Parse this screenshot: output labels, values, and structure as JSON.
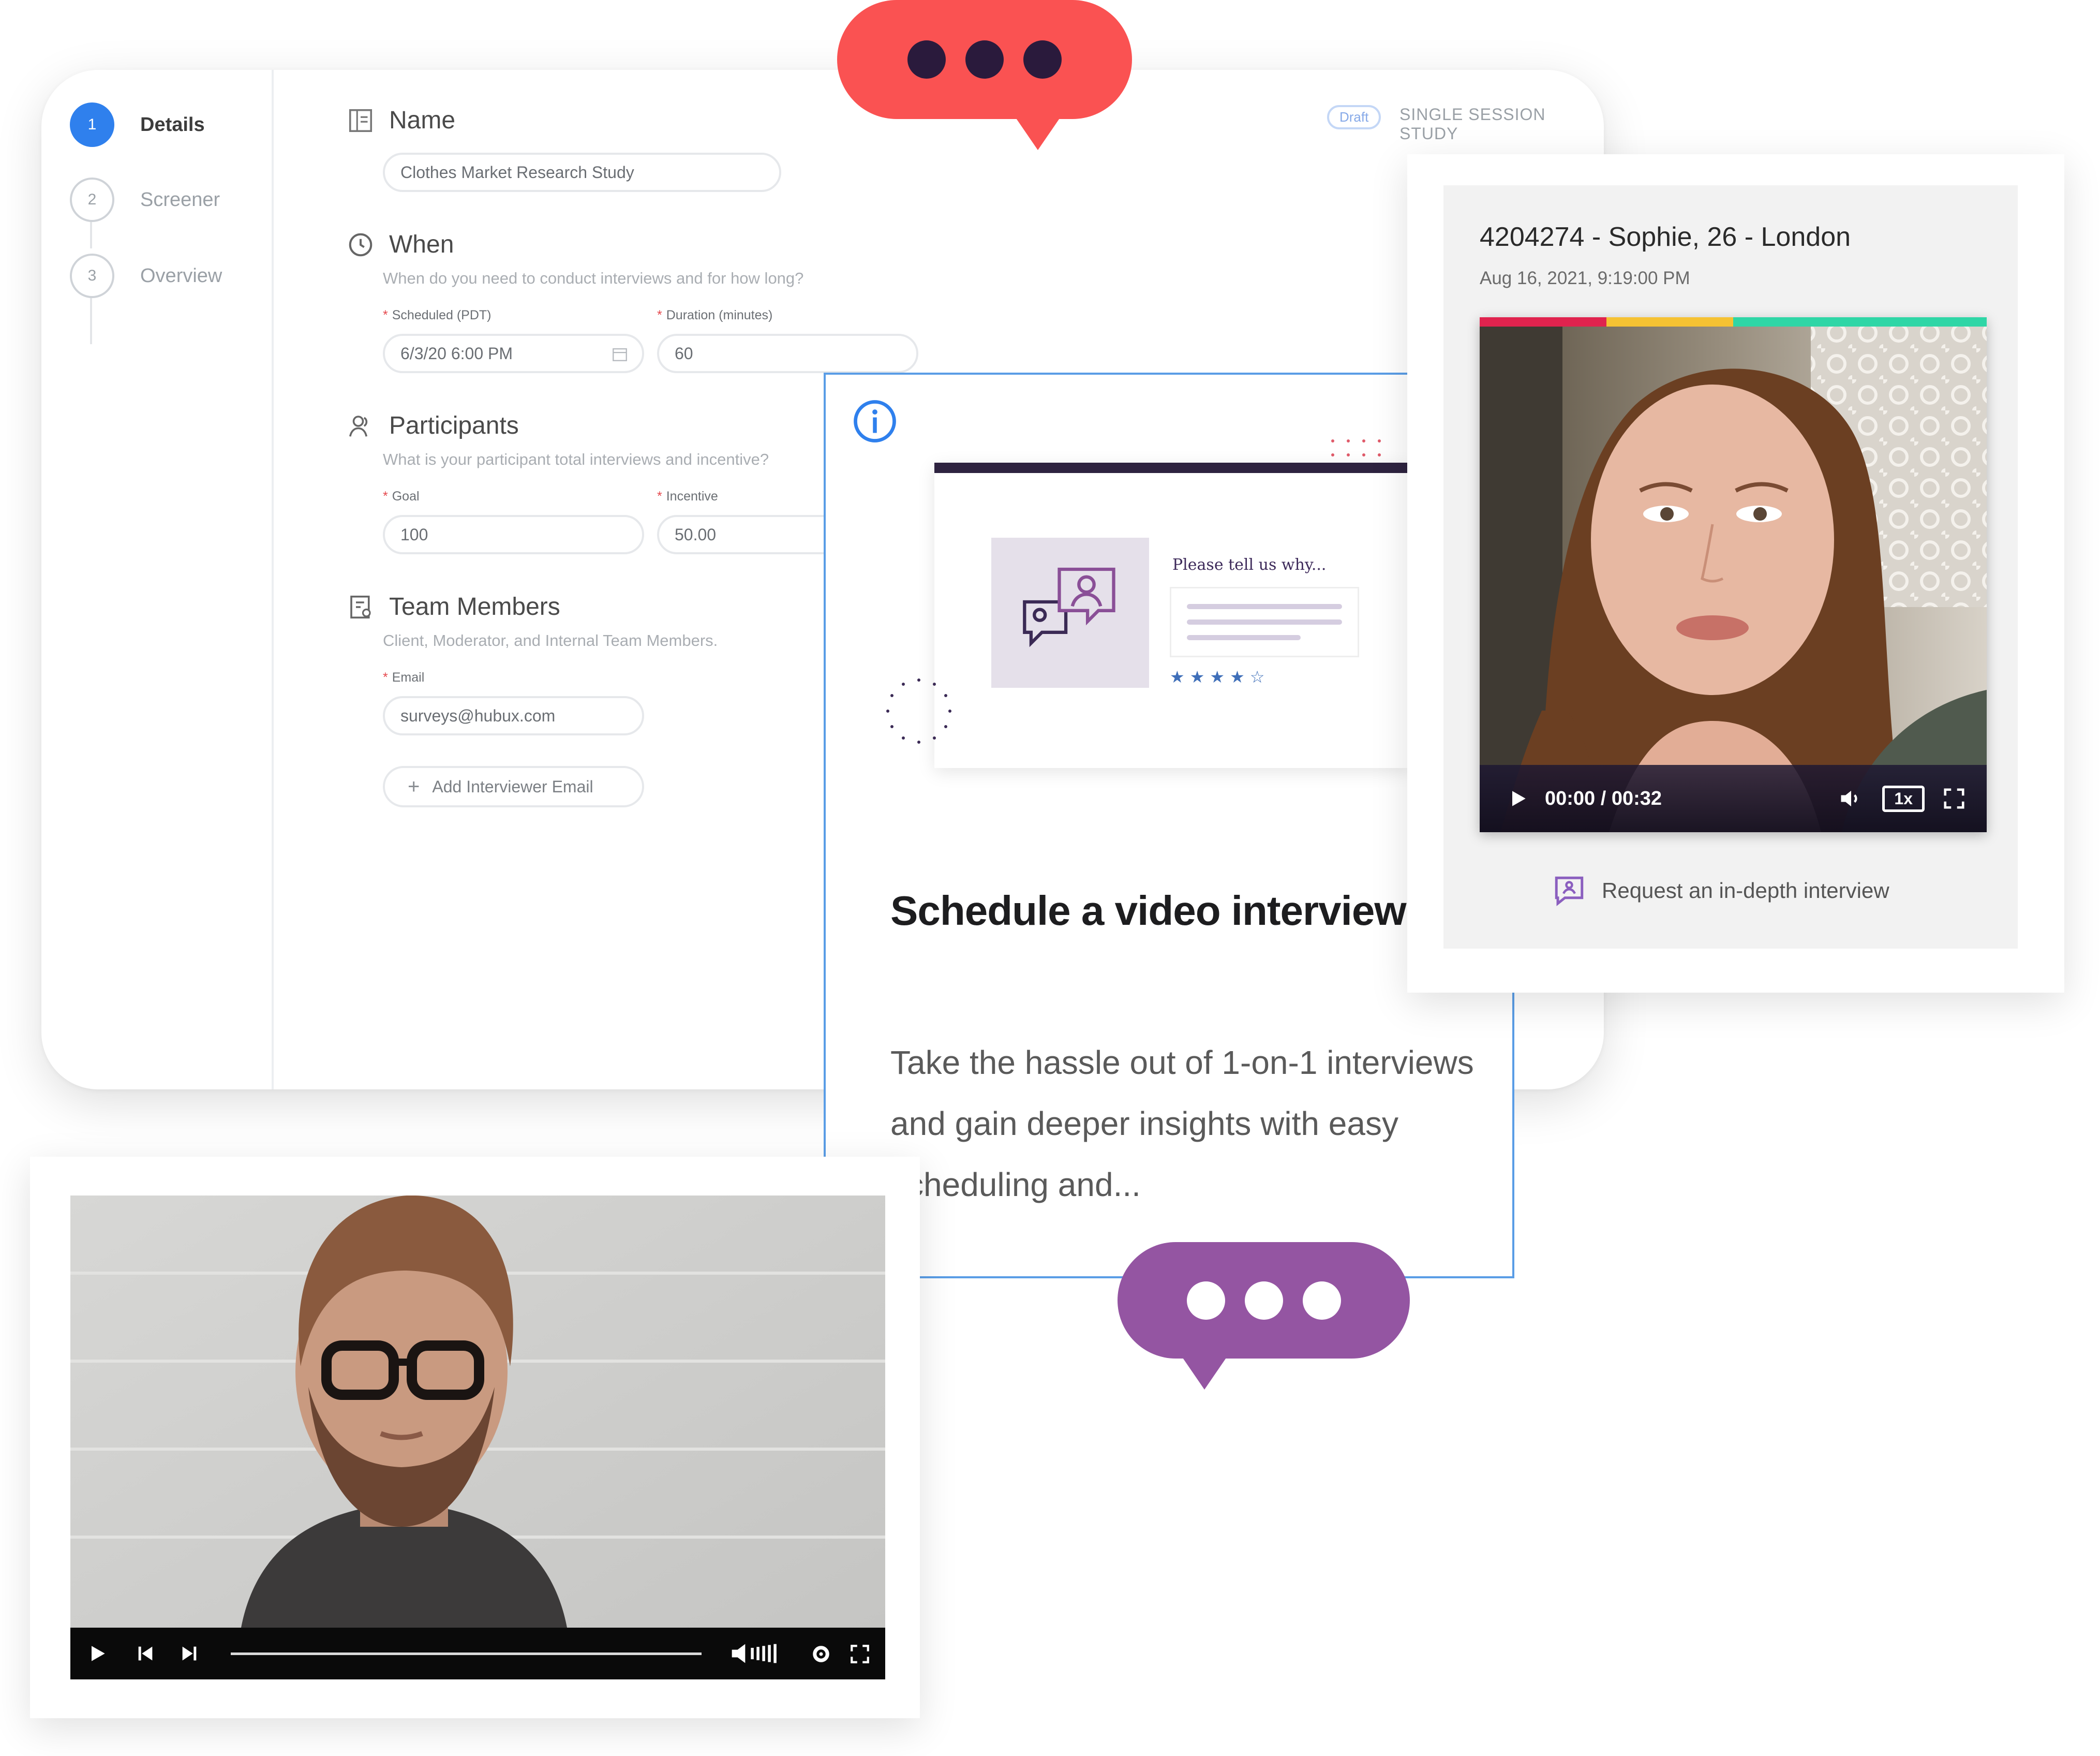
{
  "form": {
    "steps": [
      {
        "number": "1",
        "label": "Details",
        "active": true
      },
      {
        "number": "2",
        "label": "Screener",
        "active": false
      },
      {
        "number": "3",
        "label": "Overview",
        "active": false
      }
    ],
    "status_badge": "Draft",
    "study_type": "SINGLE SESSION STUDY",
    "name": {
      "title": "Name",
      "value": "Clothes Market Research Study"
    },
    "when": {
      "title": "When",
      "hint": "When do you need to conduct interviews and for how long?",
      "scheduled_label": "Scheduled (PDT)",
      "scheduled_value": "6/3/20 6:00 PM",
      "duration_label": "Duration (minutes)",
      "duration_value": "60"
    },
    "participants": {
      "title": "Participants",
      "hint": "What is your participant total interviews and incentive?",
      "goal_label": "Goal",
      "goal_value": "100",
      "incentive_label": "Incentive",
      "incentive_value": "50.00"
    },
    "team": {
      "title": "Team Members",
      "hint": "Client, Moderator, and Internal Team Members.",
      "email_label": "Email",
      "email_value": "surveys@hubux.com",
      "add_label": "Add Interviewer Email"
    }
  },
  "info_card": {
    "mock_prompt": "Please tell us why...",
    "title": "Schedule a video interview",
    "description": "Take the hassle out of 1-on-1 interviews and gain deeper insights with easy scheduling and..."
  },
  "profile": {
    "name": "4204274 - Sophie, 26 - London",
    "date": "Aug 16, 2021, 9:19:00 PM",
    "time": "00:00 / 00:32",
    "speed": "1x",
    "request_label": "Request an in-depth interview"
  },
  "colors": {
    "accent_blue": "#2f80ed",
    "bubble_red": "#fa5252",
    "bubble_purple": "#9455a2",
    "dot_dark": "#2a1a3c",
    "stripe_red": "#e0234e",
    "stripe_yellow": "#f5c233",
    "stripe_green": "#2fd6a6"
  },
  "icons": [
    "info-icon",
    "play-icon",
    "volume-icon",
    "fullscreen-icon",
    "chat-icon",
    "clock-icon",
    "people-icon",
    "calendar-icon",
    "plus-icon"
  ]
}
